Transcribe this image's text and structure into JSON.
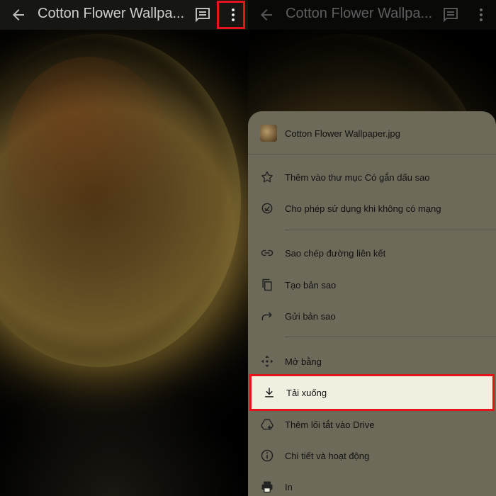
{
  "file_title": "Cotton Flower Wallpa...",
  "file_name": "Cotton Flower Wallpaper.jpg",
  "menu": {
    "items": [
      {
        "icon": "star-icon",
        "label": "Thêm vào thư mục Có gắn dấu sao"
      },
      {
        "icon": "offline-icon",
        "label": "Cho phép sử dụng khi không có mạng"
      },
      {
        "icon": "link-icon",
        "label": "Sao chép đường liên kết"
      },
      {
        "icon": "copy-icon",
        "label": "Tạo bản sao"
      },
      {
        "icon": "share-icon",
        "label": "Gửi bản sao"
      },
      {
        "icon": "open-with-icon",
        "label": "Mở bằng"
      },
      {
        "icon": "download-icon",
        "label": "Tải xuống"
      },
      {
        "icon": "add-shortcut-icon",
        "label": "Thêm lối tắt vào Drive"
      },
      {
        "icon": "info-icon",
        "label": "Chi tiết và hoạt động"
      },
      {
        "icon": "print-icon",
        "label": "In"
      }
    ]
  },
  "colors": {
    "highlight": "#e3141b",
    "sheet": "#6e6a5a",
    "selected_item": "#f1efe0"
  }
}
